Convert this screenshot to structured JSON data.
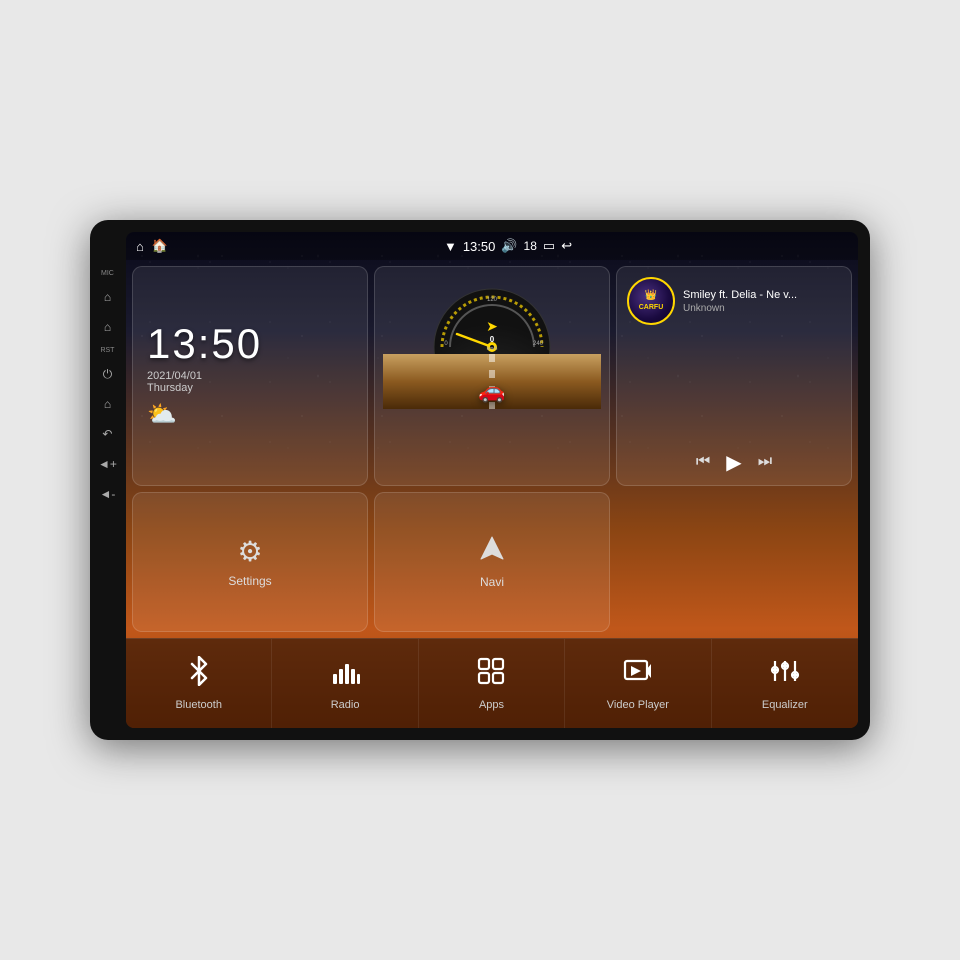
{
  "device": {
    "title": "Car Android Head Unit"
  },
  "status_bar": {
    "left_icons": [
      "home",
      "home2"
    ],
    "time": "13:50",
    "signal_icon": "wifi",
    "volume_icon": "volume",
    "volume_level": "18",
    "battery_icon": "battery",
    "back_icon": "back"
  },
  "clock": {
    "time": "13:50",
    "date": "2021/04/01",
    "day": "Thursday"
  },
  "music": {
    "title": "Smiley ft. Delia - Ne v...",
    "artist": "Unknown",
    "album_label": "CARFU"
  },
  "speedometer": {
    "value": "0",
    "unit": "km/h",
    "max": "240"
  },
  "widgets": {
    "settings_label": "Settings",
    "navi_label": "Navi"
  },
  "bottom_bar": [
    {
      "id": "bluetooth",
      "label": "Bluetooth",
      "icon": "bluetooth"
    },
    {
      "id": "radio",
      "label": "Radio",
      "icon": "radio"
    },
    {
      "id": "apps",
      "label": "Apps",
      "icon": "apps"
    },
    {
      "id": "video-player",
      "label": "Video Player",
      "icon": "video"
    },
    {
      "id": "equalizer",
      "label": "Equalizer",
      "icon": "equalizer"
    }
  ]
}
